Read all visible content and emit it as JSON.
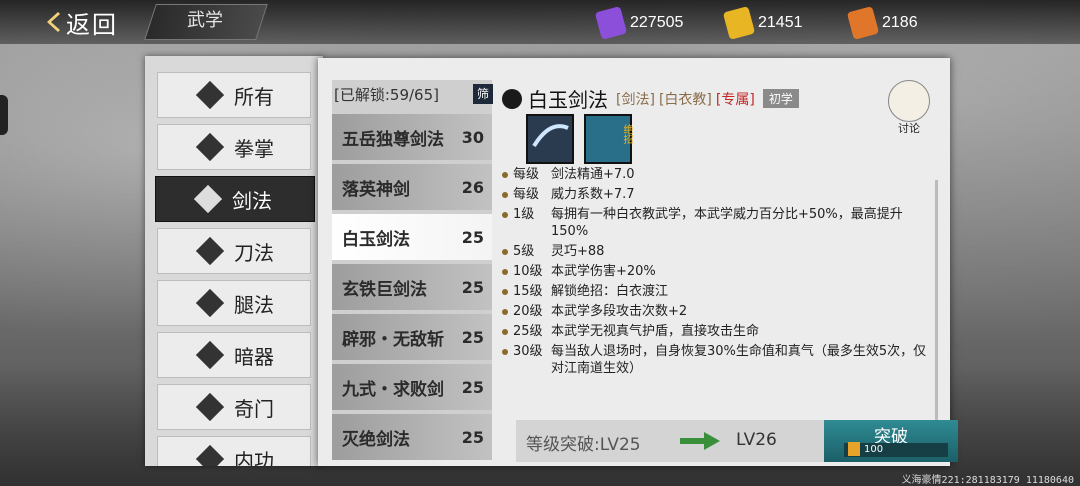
{
  "header": {
    "back_label": "返回",
    "title": "武学",
    "currencies": [
      {
        "icon": "purple-token-icon",
        "value": "227505",
        "color": "#8c4fd9"
      },
      {
        "icon": "gold-token-icon",
        "value": "21451",
        "color": "#e8b524"
      },
      {
        "icon": "orange-token-icon",
        "value": "2186",
        "color": "#e0762a"
      }
    ]
  },
  "menu": {
    "items": [
      {
        "label": "所有",
        "icon": "all-icon"
      },
      {
        "label": "拳掌",
        "icon": "fist-icon"
      },
      {
        "label": "剑法",
        "icon": "sword-icon",
        "active": true
      },
      {
        "label": "刀法",
        "icon": "blade-icon"
      },
      {
        "label": "腿法",
        "icon": "kick-icon"
      },
      {
        "label": "暗器",
        "icon": "hidden-weapon-icon"
      },
      {
        "label": "奇门",
        "icon": "exotic-icon"
      },
      {
        "label": "内功",
        "icon": "internal-icon"
      }
    ]
  },
  "skills": {
    "unlocked_label": "[已解锁:59/65]",
    "filter_label": "筛",
    "list": [
      {
        "name": "五岳独尊剑法",
        "level": "30"
      },
      {
        "name": "落英神剑",
        "level": "26"
      },
      {
        "name": "白玉剑法",
        "level": "25",
        "active": true
      },
      {
        "name": "玄铁巨剑法",
        "level": "25"
      },
      {
        "name": "辟邪・无敌斩",
        "level": "25"
      },
      {
        "name": "九式・求败剑",
        "level": "25"
      },
      {
        "name": "灭绝剑法",
        "level": "25"
      }
    ]
  },
  "detail": {
    "title": "白玉剑法",
    "tags": [
      "[剑法]",
      "[白衣教]"
    ],
    "exclusive_tag": "[专属]",
    "rank_tag": "初学",
    "discuss_label": "讨论",
    "card_badge": "绝招",
    "bonuses": [
      {
        "level": "每级",
        "text": "剑法精通+7.0"
      },
      {
        "level": "每级",
        "text": "威力系数+7.7"
      },
      {
        "level": "1级",
        "text": "每拥有一种白衣教武学，本武学威力百分比+50%，最高提升150%"
      },
      {
        "level": "5级",
        "text": "灵巧+88"
      },
      {
        "level": "10级",
        "text": "本武学伤害+20%"
      },
      {
        "level": "15级",
        "text": "解锁绝招：白衣渡江"
      },
      {
        "level": "20级",
        "text": "本武学多段攻击次数+2"
      },
      {
        "level": "25级",
        "text": "本武学无视真气护盾，直接攻击生命"
      },
      {
        "level": "30级",
        "text": "每当敌人退场时，自身恢复30%生命值和真气（最多生效5次，仅对江南道生效）"
      }
    ],
    "breakthrough": {
      "label": "等级突破:LV25",
      "next": "LV26",
      "button_label": "突破",
      "cost": "100"
    }
  },
  "footer_text": "义海豪情221:281183179 11180640"
}
